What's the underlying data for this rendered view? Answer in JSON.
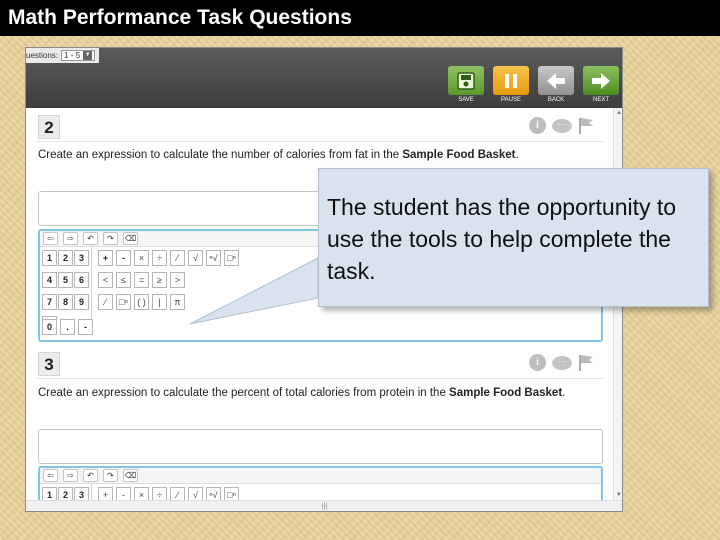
{
  "slide_title": "Math Performance Task Questions",
  "selector": {
    "label": "uestions:",
    "value": "1 - 5"
  },
  "toolbar": {
    "save": "SAVE",
    "pause": "PAUSE",
    "back": "BACK",
    "next": "NEXT"
  },
  "questions": [
    {
      "number": "2",
      "prompt_pre": "Create an expression to calculate the number of calories from fat in the ",
      "prompt_bold": "Sample Food Basket",
      "prompt_end": "."
    },
    {
      "number": "3",
      "prompt_pre": "Create an expression to calculate the percent of total calories from protein in the ",
      "prompt_bold": "Sample Food Basket",
      "prompt_end": "."
    }
  ],
  "editor_buttons": [
    "⇦",
    "⇨",
    "↶",
    "↷",
    "⌫"
  ],
  "keypad": {
    "digits": [
      [
        "1",
        "2",
        "3"
      ],
      [
        "4",
        "5",
        "6"
      ],
      [
        "7",
        "8",
        "9"
      ],
      [
        "0",
        ".",
        "-"
      ]
    ],
    "ops_row1": [
      "+",
      "-",
      "×",
      "÷",
      "⁄",
      "√",
      "ⁿ√",
      "□ⁿ"
    ],
    "ops_row2": [
      "<",
      "≤",
      "=",
      "≥",
      ">"
    ],
    "ops_row3": [
      "⁄",
      "□ⁿ",
      "( )",
      "|",
      "π"
    ]
  },
  "callout_text": "The student has the opportunity to use the tools to help complete the task."
}
